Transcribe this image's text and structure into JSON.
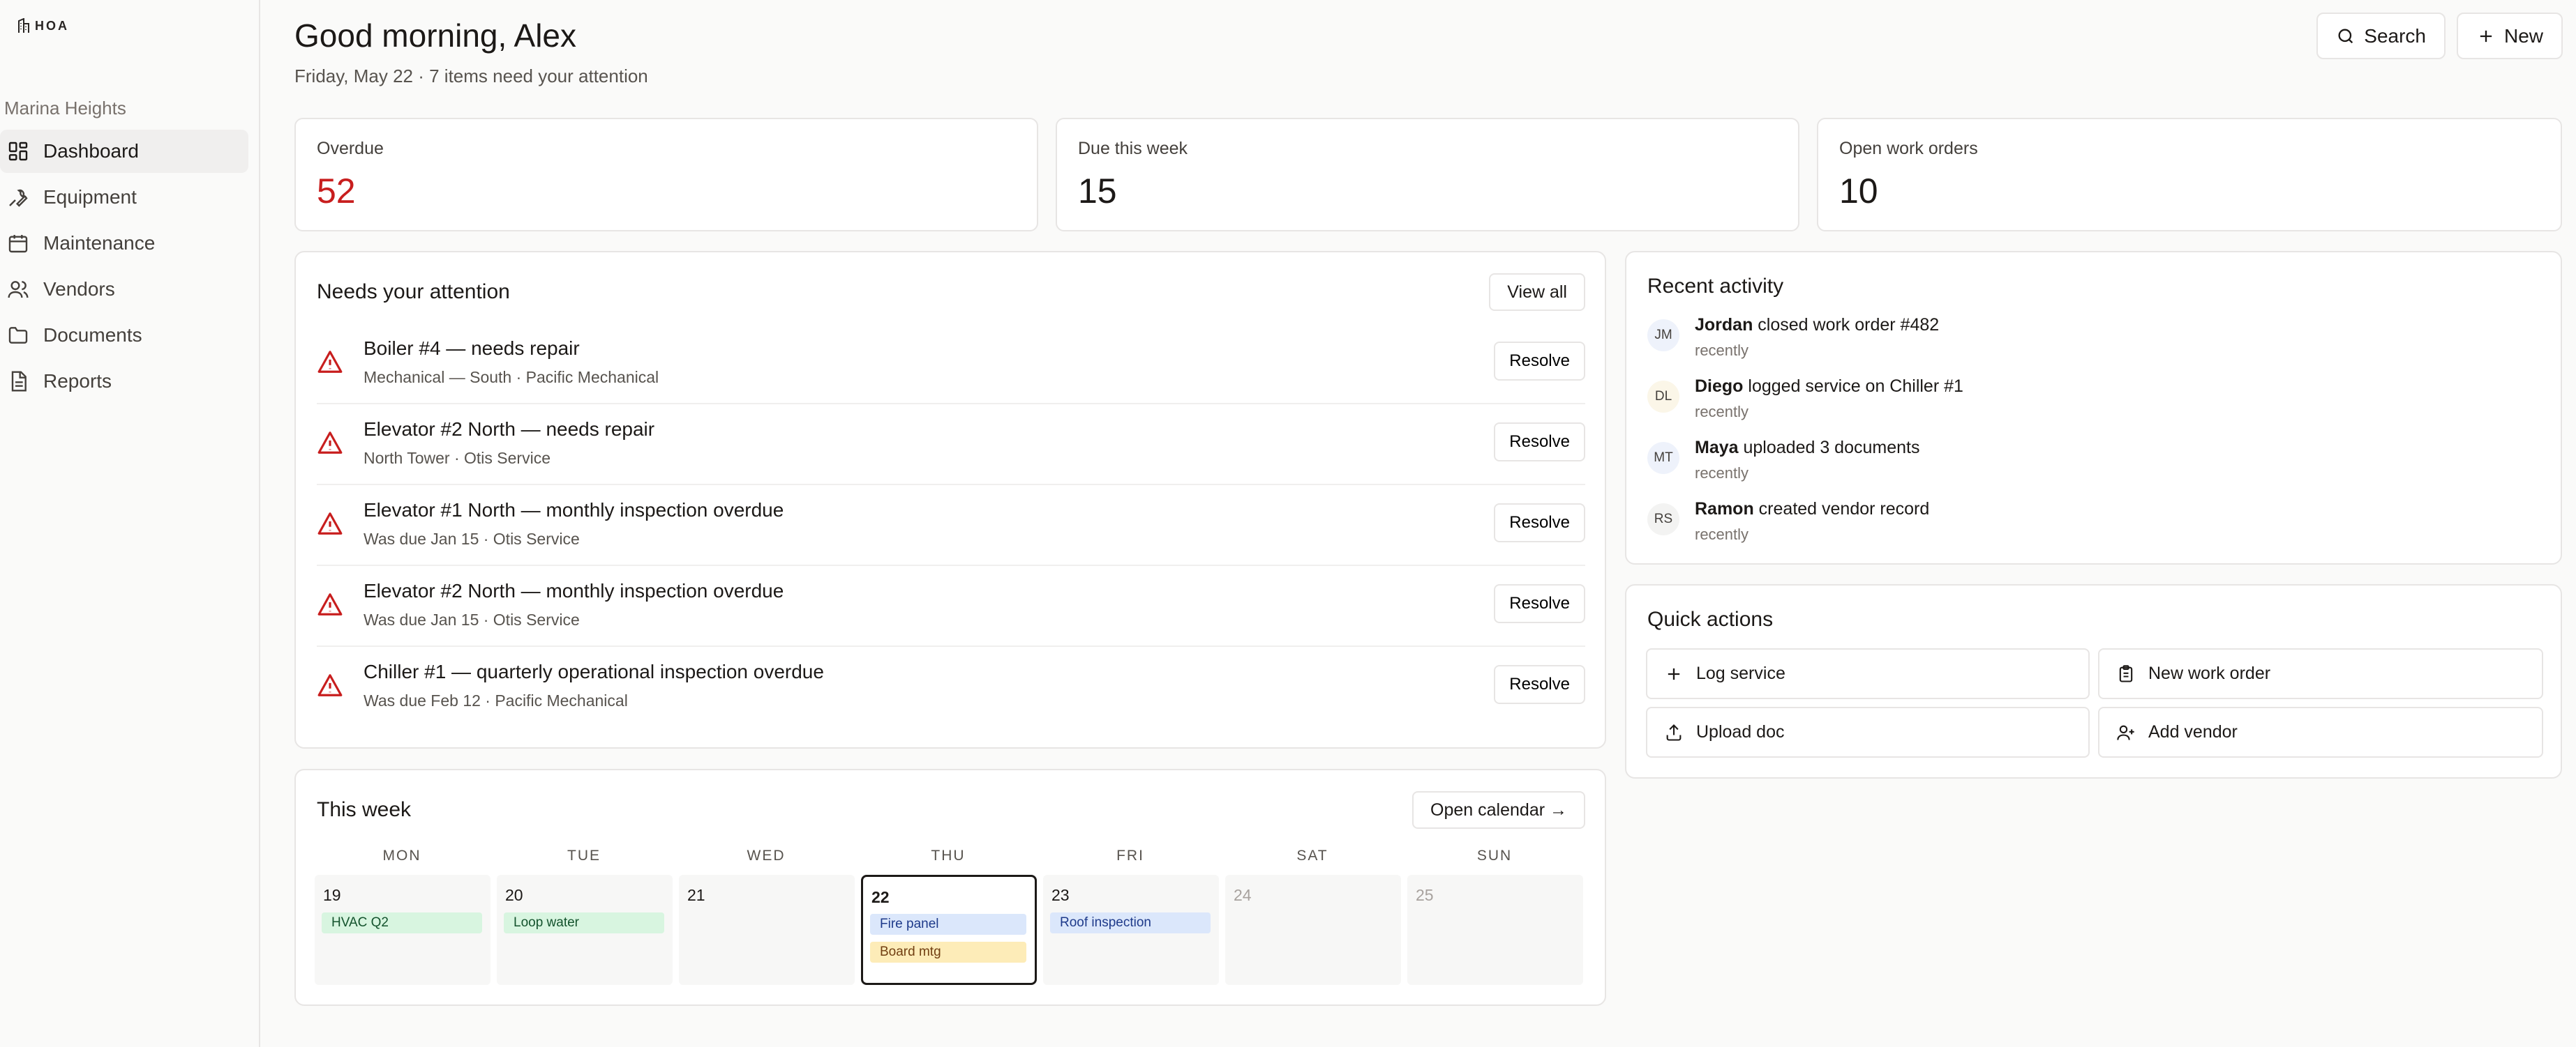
{
  "app": {
    "logo_text": "HOA",
    "org_name": "Marina Heights"
  },
  "sidebar": {
    "items": [
      {
        "label": "Dashboard",
        "icon": "grid-icon",
        "active": true
      },
      {
        "label": "Equipment",
        "icon": "wrench-icon"
      },
      {
        "label": "Maintenance",
        "icon": "calendar-icon"
      },
      {
        "label": "Vendors",
        "icon": "users-icon"
      },
      {
        "label": "Documents",
        "icon": "folder-icon"
      },
      {
        "label": "Reports",
        "icon": "file-text-icon"
      }
    ]
  },
  "header": {
    "greeting": "Good morning, Alex",
    "subtitle": "Friday, May 22 · 7 items need your attention",
    "search_label": "Search",
    "new_label": "New"
  },
  "stats": [
    {
      "label": "Overdue",
      "value": "52",
      "color": "#c81e1e"
    },
    {
      "label": "Due this week",
      "value": "15"
    },
    {
      "label": "Open work orders",
      "value": "10"
    }
  ],
  "attention": {
    "title": "Needs your attention",
    "view_all_label": "View all",
    "resolve_label": "Resolve",
    "items": [
      {
        "title": "Boiler #4 — needs repair",
        "sub": "Mechanical — South · Pacific Mechanical"
      },
      {
        "title": "Elevator #2 North — needs repair",
        "sub": "North Tower · Otis Service"
      },
      {
        "title": "Elevator #1 North — monthly inspection overdue",
        "sub": "Was due Jan 15 · Otis Service"
      },
      {
        "title": "Elevator #2 North — monthly inspection overdue",
        "sub": "Was due Jan 15 · Otis Service"
      },
      {
        "title": "Chiller #1 — quarterly operational inspection overdue",
        "sub": "Was due Feb 12 · Pacific Mechanical"
      }
    ]
  },
  "week": {
    "title": "This week",
    "open_calendar_label": "Open calendar →",
    "days": [
      {
        "name": "MON",
        "num": "19",
        "events": [
          {
            "label": "HVAC Q2",
            "color": "green"
          }
        ]
      },
      {
        "name": "TUE",
        "num": "20",
        "events": [
          {
            "label": "Loop water",
            "color": "green"
          }
        ]
      },
      {
        "name": "WED",
        "num": "21",
        "events": []
      },
      {
        "name": "THU",
        "num": "22",
        "today": true,
        "events": [
          {
            "label": "Fire panel",
            "color": "blue"
          },
          {
            "label": "Board mtg",
            "color": "yellow"
          }
        ]
      },
      {
        "name": "FRI",
        "num": "23",
        "events": [
          {
            "label": "Roof inspection",
            "color": "blue"
          }
        ]
      },
      {
        "name": "SAT",
        "num": "24",
        "muted": true,
        "events": []
      },
      {
        "name": "SUN",
        "num": "25",
        "muted": true,
        "events": []
      }
    ]
  },
  "activity": {
    "title": "Recent activity",
    "items": [
      {
        "initials": "JM",
        "name": "Jordan",
        "action": " closed work order #482",
        "when": "recently",
        "avatar_bg": "#eef2fb"
      },
      {
        "initials": "DL",
        "name": "Diego",
        "action": " logged service on Chiller #1",
        "when": "recently",
        "avatar_bg": "#fbf6e8"
      },
      {
        "initials": "MT",
        "name": "Maya",
        "action": " uploaded 3 documents",
        "when": "recently",
        "avatar_bg": "#eef2fb"
      },
      {
        "initials": "RS",
        "name": "Ramon",
        "action": " created vendor record",
        "when": "recently",
        "avatar_bg": "#f3f3f2"
      }
    ]
  },
  "quick_actions": {
    "title": "Quick actions",
    "items": [
      {
        "label": "Log service",
        "icon": "plus-icon"
      },
      {
        "label": "New work order",
        "icon": "clipboard-icon"
      },
      {
        "label": "Upload doc",
        "icon": "upload-icon"
      },
      {
        "label": "Add vendor",
        "icon": "user-plus-icon"
      }
    ]
  }
}
